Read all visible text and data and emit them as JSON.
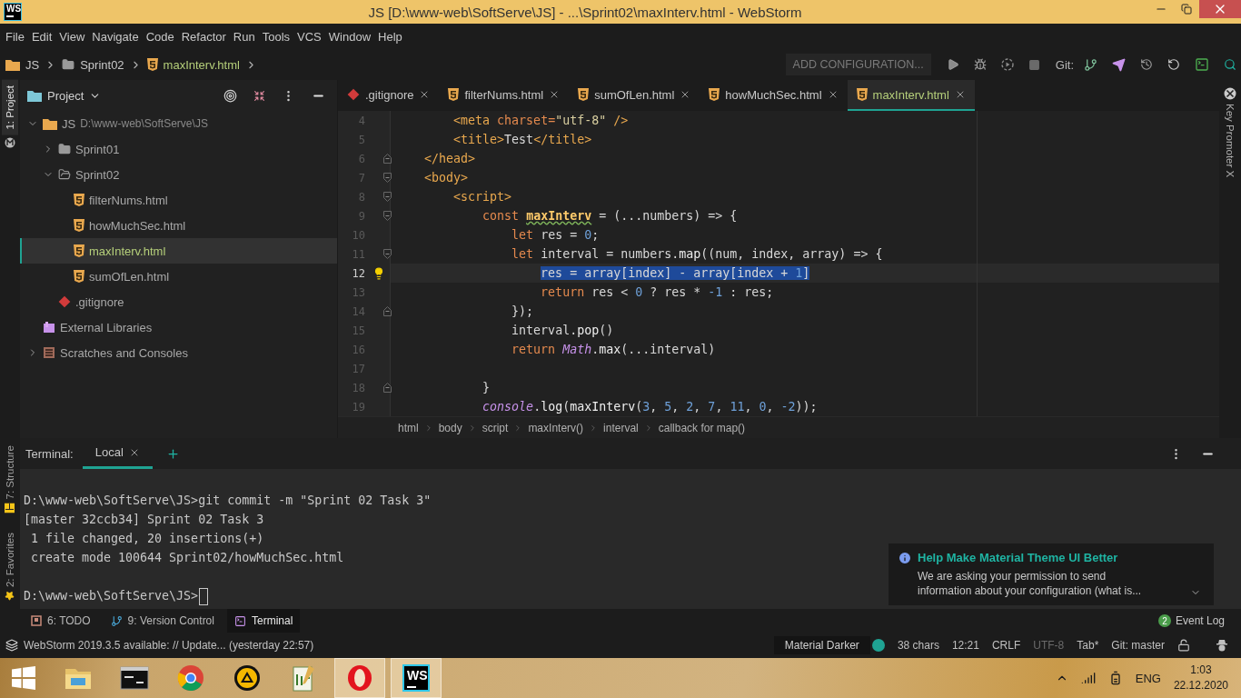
{
  "window": {
    "logo": "WS",
    "title": "JS [D:\\www-web\\SoftServe\\JS] - ...\\Sprint02\\maxInterv.html - WebStorm"
  },
  "menu": [
    "File",
    "Edit",
    "View",
    "Navigate",
    "Code",
    "Refactor",
    "Run",
    "Tools",
    "VCS",
    "Window",
    "Help"
  ],
  "navbar": {
    "crumbs": [
      {
        "label": "JS",
        "kind": "project"
      },
      {
        "label": "Sprint02",
        "kind": "folder"
      },
      {
        "label": "maxInterv.html",
        "kind": "file"
      }
    ],
    "run_config": "ADD CONFIGURATION...",
    "git_label": "Git:"
  },
  "left_strip": [
    {
      "label": "1: Project",
      "selected": true
    },
    {
      "label": "7: Structure",
      "selected": false
    },
    {
      "label": "2: Favorites",
      "selected": false
    }
  ],
  "right_strip": {
    "label": "Key Promoter X"
  },
  "project": {
    "title": "Project",
    "tree": [
      {
        "label": "JS",
        "path": "D:\\www-web\\SoftServe\\JS",
        "kind": "project",
        "expanded": true,
        "selected": false,
        "children": [
          {
            "label": "Sprint01",
            "kind": "folder",
            "expanded": false,
            "selected": false
          },
          {
            "label": "Sprint02",
            "kind": "folder",
            "expanded": true,
            "selected": false,
            "children": [
              {
                "label": "filterNums.html",
                "kind": "html",
                "selected": false
              },
              {
                "label": "howMuchSec.html",
                "kind": "html",
                "selected": false
              },
              {
                "label": "maxInterv.html",
                "kind": "html",
                "selected": true
              },
              {
                "label": "sumOfLen.html",
                "kind": "html",
                "selected": false
              }
            ]
          },
          {
            "label": ".gitignore",
            "kind": "git",
            "selected": false
          }
        ]
      },
      {
        "label": "External Libraries",
        "kind": "library",
        "selected": false
      },
      {
        "label": "Scratches and Consoles",
        "kind": "scratches",
        "expanded": false,
        "selected": false
      }
    ]
  },
  "editor": {
    "tabs": [
      {
        "label": ".gitignore",
        "kind": "git",
        "selected": false
      },
      {
        "label": "filterNums.html",
        "kind": "html",
        "selected": false
      },
      {
        "label": "sumOfLen.html",
        "kind": "html",
        "selected": false
      },
      {
        "label": "howMuchSec.html",
        "kind": "html",
        "selected": false
      },
      {
        "label": "maxInterv.html",
        "kind": "html",
        "selected": true
      }
    ],
    "lines": [
      {
        "number": "4",
        "current": false,
        "tokens": [
          {
            "text": "        <meta ",
            "kind": "tag"
          },
          {
            "text": "charset=",
            "kind": "attr"
          },
          {
            "text": "\"utf-8\"",
            "kind": "str"
          },
          {
            "text": " />",
            "kind": "tag"
          }
        ]
      },
      {
        "number": "5",
        "current": false,
        "tokens": [
          {
            "text": "        <title>",
            "kind": "tag"
          },
          {
            "text": "Test",
            "kind": "plain"
          },
          {
            "text": "</title>",
            "kind": "tag"
          }
        ]
      },
      {
        "number": "6",
        "current": false,
        "fold_end": true,
        "tokens": [
          {
            "text": "    </head>",
            "kind": "tag"
          }
        ]
      },
      {
        "number": "7",
        "current": false,
        "fold_start": true,
        "tokens": [
          {
            "text": "    <body>",
            "kind": "tag"
          }
        ]
      },
      {
        "number": "8",
        "current": false,
        "fold_start": true,
        "tokens": [
          {
            "text": "        <script>",
            "kind": "tag"
          }
        ]
      },
      {
        "number": "9",
        "current": false,
        "fold_start": true,
        "tokens": [
          {
            "text": "            const ",
            "kind": "kw"
          },
          {
            "text": "maxInterv",
            "kind": "def",
            "warning": true
          },
          {
            "text": " = (...numbers) => {",
            "kind": "plain"
          }
        ]
      },
      {
        "number": "10",
        "current": false,
        "tokens": [
          {
            "text": "                let ",
            "kind": "kw"
          },
          {
            "text": "res = ",
            "kind": "plain"
          },
          {
            "text": "0",
            "kind": "num"
          },
          {
            "text": ";",
            "kind": "plain"
          }
        ]
      },
      {
        "number": "11",
        "current": false,
        "fold_start": true,
        "tokens": [
          {
            "text": "                let ",
            "kind": "kw"
          },
          {
            "text": "interval = numbers.",
            "kind": "plain"
          },
          {
            "text": "map",
            "kind": "fn"
          },
          {
            "text": "((num, index, array) => {",
            "kind": "plain"
          }
        ]
      },
      {
        "number": "12",
        "current": true,
        "bulb": true,
        "tokens": [
          {
            "text": "                    res = array[index] - array[index + ",
            "kind": "plain",
            "selected": true
          },
          {
            "text": "1",
            "kind": "num",
            "selected": true
          },
          {
            "text": "]",
            "kind": "plain",
            "selected": true
          }
        ]
      },
      {
        "number": "13",
        "current": false,
        "tokens": [
          {
            "text": "                    return ",
            "kind": "kw"
          },
          {
            "text": "res < ",
            "kind": "plain"
          },
          {
            "text": "0",
            "kind": "num"
          },
          {
            "text": " ? res * ",
            "kind": "plain"
          },
          {
            "text": "-1",
            "kind": "num"
          },
          {
            "text": " : res;",
            "kind": "plain"
          }
        ]
      },
      {
        "number": "14",
        "current": false,
        "fold_end": true,
        "tokens": [
          {
            "text": "                });",
            "kind": "plain"
          }
        ]
      },
      {
        "number": "15",
        "current": false,
        "tokens": [
          {
            "text": "                interval.",
            "kind": "plain"
          },
          {
            "text": "pop",
            "kind": "fn"
          },
          {
            "text": "()",
            "kind": "plain"
          }
        ]
      },
      {
        "number": "16",
        "current": false,
        "tokens": [
          {
            "text": "                return ",
            "kind": "kw"
          },
          {
            "text": "Math",
            "kind": "cls"
          },
          {
            "text": ".",
            "kind": "plain"
          },
          {
            "text": "max",
            "kind": "fn"
          },
          {
            "text": "(...interval)",
            "kind": "plain"
          }
        ]
      },
      {
        "number": "17",
        "current": false
      },
      {
        "number": "18",
        "current": false,
        "fold_end": true,
        "tokens": [
          {
            "text": "            }",
            "kind": "plain"
          }
        ]
      },
      {
        "number": "19",
        "current": false,
        "tokens": [
          {
            "text": "            console",
            "kind": "cls"
          },
          {
            "text": ".",
            "kind": "plain"
          },
          {
            "text": "log",
            "kind": "fn"
          },
          {
            "text": "(",
            "kind": "plain"
          },
          {
            "text": "maxInterv",
            "kind": "fn"
          },
          {
            "text": "(",
            "kind": "plain"
          },
          {
            "text": "3",
            "kind": "num"
          },
          {
            "text": ", ",
            "kind": "plain"
          },
          {
            "text": "5",
            "kind": "num"
          },
          {
            "text": ", ",
            "kind": "plain"
          },
          {
            "text": "2",
            "kind": "num"
          },
          {
            "text": ", ",
            "kind": "plain"
          },
          {
            "text": "7",
            "kind": "num"
          },
          {
            "text": ", ",
            "kind": "plain"
          },
          {
            "text": "11",
            "kind": "num"
          },
          {
            "text": ", ",
            "kind": "plain"
          },
          {
            "text": "0",
            "kind": "num"
          },
          {
            "text": ", ",
            "kind": "plain"
          },
          {
            "text": "-2",
            "kind": "num"
          },
          {
            "text": "));",
            "kind": "plain"
          }
        ]
      }
    ],
    "breadcrumbs": [
      "html",
      "body",
      "script",
      "maxInterv()",
      "interval",
      "callback for map()"
    ]
  },
  "terminal": {
    "title": "Terminal:",
    "tabs": [
      {
        "label": "Local",
        "selected": true
      }
    ],
    "output": [
      "D:\\www-web\\SoftServe\\JS>git commit -m \"Sprint 02 Task 3\"",
      "[master 32ccb34] Sprint 02 Task 3",
      " 1 file changed, 20 insertions(+)",
      " create mode 100644 Sprint02/howMuchSec.html"
    ],
    "prompt": "D:\\www-web\\SoftServe\\JS>"
  },
  "notification": {
    "title": "Help Make Material Theme UI Better",
    "body": "We are asking your permission to send information about your configuration (what is..."
  },
  "tool_tabs": [
    {
      "label": "6: TODO",
      "kind": "todo",
      "selected": false
    },
    {
      "label": "9: Version Control",
      "kind": "vcs",
      "selected": false
    },
    {
      "label": "Terminal",
      "kind": "terminal",
      "selected": true
    }
  ],
  "event_log": {
    "count": "2",
    "label": "Event Log"
  },
  "status_bar": {
    "message": "WebStorm 2019.3.5 available: // Update... (yesterday 22:57)",
    "theme": "Material Darker",
    "chars": "38 chars",
    "position": "12:21",
    "line_sep": "CRLF",
    "encoding": "UTF-8",
    "encoding_disabled": true,
    "indent": "Tab*",
    "branch": "Git: master"
  },
  "taskbar": {
    "apps": [
      {
        "kind": "files",
        "active": false
      },
      {
        "kind": "console",
        "active": false
      },
      {
        "kind": "browser",
        "active": false
      },
      {
        "kind": "player",
        "active": false
      },
      {
        "kind": "notepad",
        "active": false
      },
      {
        "kind": "ring",
        "active": true
      },
      {
        "kind": "ide",
        "label": "WS",
        "active": true
      }
    ],
    "language": "ENG",
    "time": "1:03",
    "date": "22.12.2020"
  }
}
